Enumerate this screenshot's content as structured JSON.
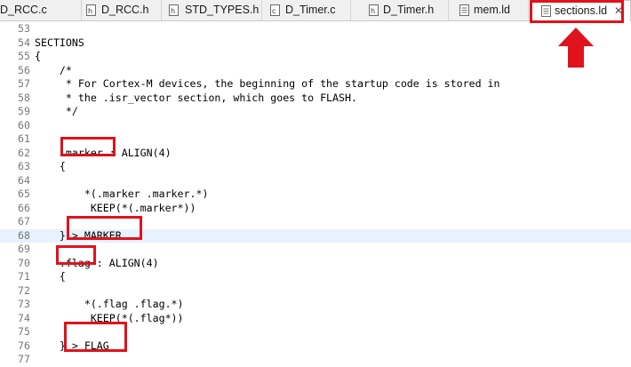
{
  "tabs": [
    {
      "label": "D_RCC.c",
      "icon": "c-file-icon",
      "active": false
    },
    {
      "label": "D_RCC.h",
      "icon": "h-file-icon",
      "active": false
    },
    {
      "label": "STD_TYPES.h",
      "icon": "h-file-icon",
      "active": false
    },
    {
      "label": "D_Timer.c",
      "icon": "c-file-icon",
      "active": false
    },
    {
      "label": "D_Timer.h",
      "icon": "h-file-icon",
      "active": false
    },
    {
      "label": "mem.ld",
      "icon": "text-file-icon",
      "active": false
    },
    {
      "label": "sections.ld",
      "icon": "text-file-icon",
      "active": true,
      "close": "✕"
    }
  ],
  "editor": {
    "current_line": "68",
    "lines": [
      {
        "n": "53",
        "text": ""
      },
      {
        "n": "54",
        "text": "SECTIONS"
      },
      {
        "n": "55",
        "text": "{"
      },
      {
        "n": "56",
        "text": "    /*"
      },
      {
        "n": "57",
        "text": "     * For Cortex-M devices, the beginning of the startup code is stored in"
      },
      {
        "n": "58",
        "text": "     * the .isr_vector section, which goes to FLASH."
      },
      {
        "n": "59",
        "text": "     */"
      },
      {
        "n": "60",
        "text": ""
      },
      {
        "n": "61",
        "text": ""
      },
      {
        "n": "62",
        "text": "    .marker : ALIGN(4)"
      },
      {
        "n": "63",
        "text": "    {"
      },
      {
        "n": "64",
        "text": ""
      },
      {
        "n": "65",
        "text": "        *(.marker .marker.*)"
      },
      {
        "n": "66",
        "text": "         KEEP(*(.marker*))"
      },
      {
        "n": "67",
        "text": ""
      },
      {
        "n": "68",
        "text": "    } > MARKER"
      },
      {
        "n": "69",
        "text": ""
      },
      {
        "n": "70",
        "text": "    .flag : ALIGN(4)"
      },
      {
        "n": "71",
        "text": "    {"
      },
      {
        "n": "72",
        "text": ""
      },
      {
        "n": "73",
        "text": "        *(.flag .flag.*)"
      },
      {
        "n": "74",
        "text": "         KEEP(*(.flag*))"
      },
      {
        "n": "75",
        "text": ""
      },
      {
        "n": "76",
        "text": "    } > FLAG"
      },
      {
        "n": "77",
        "text": ""
      }
    ]
  },
  "annotation_color": "#e0121b"
}
